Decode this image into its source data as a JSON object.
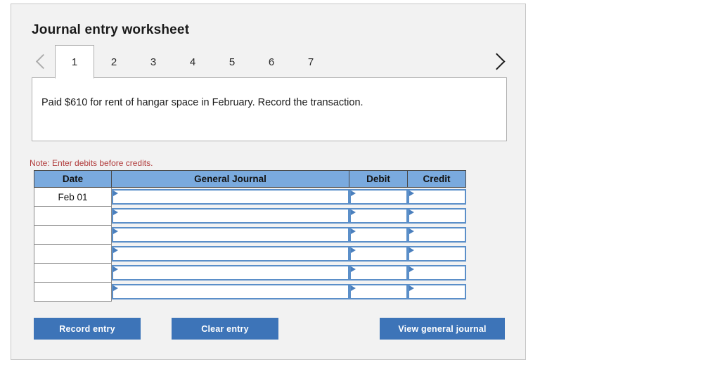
{
  "panel": {
    "title": "Journal entry worksheet"
  },
  "pager": {
    "prev_icon": "chevron-left-icon",
    "next_icon": "chevron-right-icon",
    "tabs": [
      {
        "label": "1",
        "active": true
      },
      {
        "label": "2",
        "active": false
      },
      {
        "label": "3",
        "active": false
      },
      {
        "label": "4",
        "active": false
      },
      {
        "label": "5",
        "active": false
      },
      {
        "label": "6",
        "active": false
      },
      {
        "label": "7",
        "active": false
      }
    ]
  },
  "transaction": {
    "text": "Paid $610 for rent of hangar space in February. Record the transaction."
  },
  "note": {
    "text": "Note: Enter debits before credits."
  },
  "journal_table": {
    "headers": [
      "Date",
      "General Journal",
      "Debit",
      "Credit"
    ],
    "rows": [
      {
        "date": "Feb 01",
        "general_journal": "",
        "debit": "",
        "credit": ""
      },
      {
        "date": "",
        "general_journal": "",
        "debit": "",
        "credit": ""
      },
      {
        "date": "",
        "general_journal": "",
        "debit": "",
        "credit": ""
      },
      {
        "date": "",
        "general_journal": "",
        "debit": "",
        "credit": ""
      },
      {
        "date": "",
        "general_journal": "",
        "debit": "",
        "credit": ""
      },
      {
        "date": "",
        "general_journal": "",
        "debit": "",
        "credit": ""
      }
    ]
  },
  "buttons": {
    "record": "Record entry",
    "clear": "Clear entry",
    "view": "View general journal"
  },
  "colors": {
    "header_blue": "#7aaade",
    "button_blue": "#3d74b8",
    "note_red": "#b03a3a",
    "field_border": "#5b8fc9",
    "panel_bg": "#f2f2f2"
  }
}
